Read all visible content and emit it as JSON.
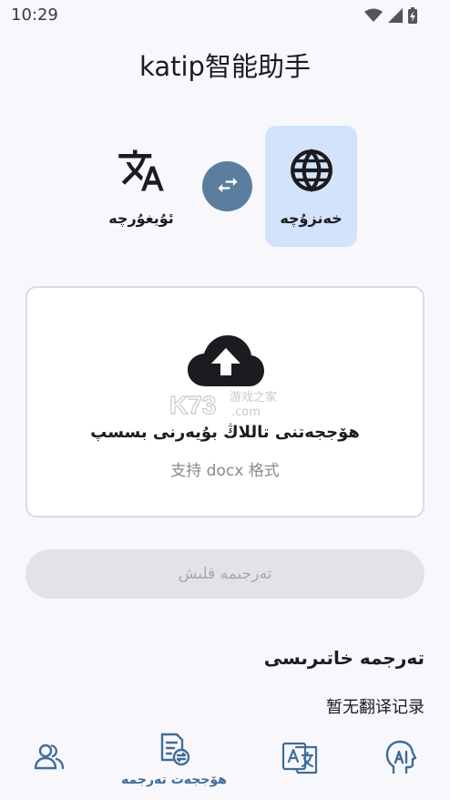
{
  "status_bar": {
    "time": "10:29",
    "icons": [
      "wifi-icon",
      "signal-icon",
      "battery-charging-icon"
    ]
  },
  "app": {
    "title": "katip智能助手"
  },
  "language": {
    "source_label": "ئۇيغۇرچە",
    "source_icon": "translate-icon",
    "target_label": "خەنزۇچە",
    "target_icon": "globe-icon",
    "swap_icon": "swap-arrows-icon",
    "target_highlight_color": "#d3e3fb",
    "swap_color": "#5b7e9e"
  },
  "upload": {
    "icon": "cloud-upload-icon",
    "title": "ھۆججەتنى تاللاڭ بۇيەرنى بسسپ",
    "hint": "支持 docx 格式",
    "watermark": "K73 游戏之家 .com"
  },
  "actions": {
    "translate_label": "تەرجىمە قلىش"
  },
  "history": {
    "title": "تەرجمە خاتىرىسى",
    "empty_text": "暂无翻译记录"
  },
  "nav": {
    "items": [
      {
        "icon": "users-icon",
        "label": ""
      },
      {
        "icon": "document-translate-icon",
        "label": "ھۆججەت تەرجمە",
        "active": true
      },
      {
        "icon": "translate-box-icon",
        "label": ""
      },
      {
        "icon": "ai-head-icon",
        "label": ""
      }
    ],
    "active_color": "#3f6e97"
  }
}
